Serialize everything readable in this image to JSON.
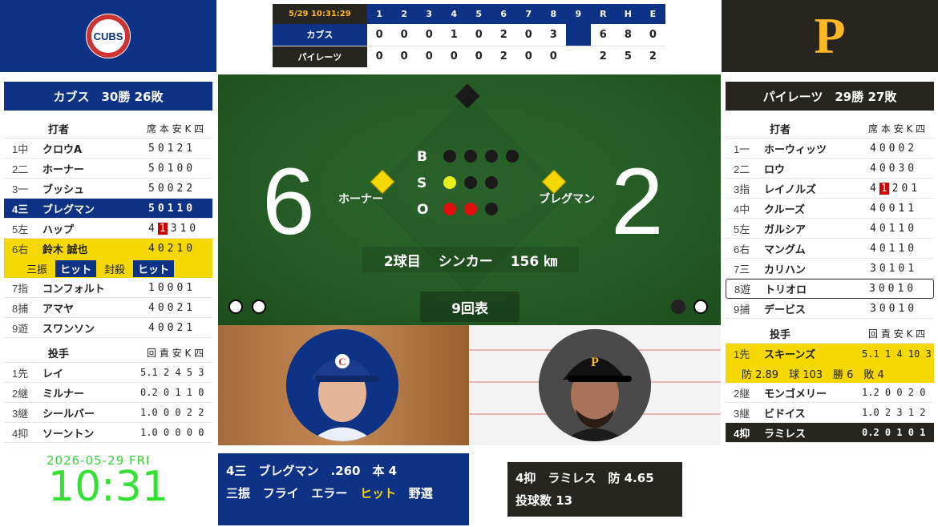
{
  "linescore": {
    "time": "5/29 10:31:29",
    "innings": [
      "1",
      "2",
      "3",
      "4",
      "5",
      "6",
      "7",
      "8",
      "9"
    ],
    "rhe": [
      "R",
      "H",
      "E"
    ],
    "rows": [
      {
        "team": "カブス",
        "scores": [
          "0",
          "0",
          "0",
          "1",
          "0",
          "2",
          "0",
          "3",
          ""
        ],
        "rhe": [
          "6",
          "8",
          "0"
        ]
      },
      {
        "team": "パイレーツ",
        "scores": [
          "0",
          "0",
          "0",
          "0",
          "0",
          "2",
          "0",
          "0",
          ""
        ],
        "rhe": [
          "2",
          "5",
          "2"
        ]
      }
    ]
  },
  "logos": {
    "cubs": "CUBS",
    "pirates": "P"
  },
  "left": {
    "team_header": "カブス　30勝 26敗",
    "batters_header": {
      "title": "打者",
      "cols": "席 本 安 K 四"
    },
    "batters": [
      {
        "ord": "1中",
        "name": "クロウA",
        "stats": "50121"
      },
      {
        "ord": "2二",
        "name": "ホーナー",
        "stats": "50100"
      },
      {
        "ord": "3一",
        "name": "ブッシュ",
        "stats": "50022"
      },
      {
        "ord": "4三",
        "name": "ブレグマン",
        "stats": "50110"
      },
      {
        "ord": "5左",
        "name": "ハップ",
        "stats_pre": "4",
        "stats_hl": "1",
        "stats_post": "310"
      },
      {
        "ord": "6右",
        "name": "鈴木 誠也",
        "stats": "40210"
      },
      {
        "ord": "7指",
        "name": "コンフォルト",
        "stats": "10001"
      },
      {
        "ord": "8捕",
        "name": "アマヤ",
        "stats": "40021"
      },
      {
        "ord": "9遊",
        "name": "スワンソン",
        "stats": "40021"
      }
    ],
    "suzuki_results": [
      "三振",
      "ヒット",
      "封殺",
      "ヒット"
    ],
    "pitchers_header": {
      "title": "投手",
      "cols": "回 責 安 K 四"
    },
    "pitchers": [
      {
        "ord": "1先",
        "name": "レイ",
        "stats": "5.1 2 4 5 3"
      },
      {
        "ord": "2継",
        "name": "ミルナー",
        "stats": "0.2 0 1 1 0"
      },
      {
        "ord": "3継",
        "name": "シールバー",
        "stats": "1.0 0 0 2 2"
      },
      {
        "ord": "4抑",
        "name": "ソーントン",
        "stats": "1.0 0 0 0 0"
      }
    ]
  },
  "right": {
    "team_header": "パイレーツ　29勝 27敗",
    "batters_header": {
      "title": "打者",
      "cols": "席 本 安 K 四"
    },
    "batters": [
      {
        "ord": "1一",
        "name": "ホーウィッツ",
        "stats": "40002"
      },
      {
        "ord": "2二",
        "name": "ロウ",
        "stats": "40030"
      },
      {
        "ord": "3指",
        "name": "レイノルズ",
        "stats_pre": "4",
        "stats_hl": "1",
        "stats_post": "201"
      },
      {
        "ord": "4中",
        "name": "クルーズ",
        "stats": "40011"
      },
      {
        "ord": "5左",
        "name": "ガルシア",
        "stats": "40110"
      },
      {
        "ord": "6右",
        "name": "マングム",
        "stats": "40110"
      },
      {
        "ord": "7三",
        "name": "カリハン",
        "stats": "30101"
      },
      {
        "ord": "8遊",
        "name": "トリオロ",
        "stats": "30010"
      },
      {
        "ord": "9捕",
        "name": "デービス",
        "stats": "30010"
      }
    ],
    "pitchers_header": {
      "title": "投手",
      "cols": "回 責 安 K 四"
    },
    "pitchers": [
      {
        "ord": "1先",
        "name": "スキーンズ",
        "stats": "5.1 1 4 10 3"
      },
      {
        "ord": "2継",
        "name": "モンゴメリー",
        "stats": "1.2 0 0 2 0"
      },
      {
        "ord": "3継",
        "name": "ビドイス",
        "stats": "1.0 2 3 1 2"
      },
      {
        "ord": "4抑",
        "name": "ラミレス",
        "stats": "0.2 0 1 0 1"
      }
    ],
    "skenes_line": "防 2.89　球 103　勝 6　敗 4"
  },
  "field": {
    "away_score": "6",
    "home_score": "2",
    "runner_left": "ホーナー",
    "runner_right": "ブレグマン",
    "labels": {
      "b": "B",
      "s": "S",
      "o": "O"
    },
    "balls": 0,
    "strikes": 1,
    "outs": 2,
    "pitch_count": "2球目",
    "pitch_type": "シンカー",
    "pitch_speed": "156 ㎞",
    "inning": "9回表"
  },
  "batter_card": {
    "line1": "4三　ブレグマン　.260　本 4",
    "results": [
      "三振",
      "フライ",
      "エラー",
      "ヒット",
      "野選"
    ]
  },
  "pitcher_card": {
    "line1": "4抑　ラミレス　防 4.65",
    "line2": "投球数 13"
  },
  "clock": {
    "date": "2026-05-29 FRI",
    "time": "10:31"
  },
  "colors": {
    "cubs_blue": "#0e3386",
    "pirates_black": "#27251f",
    "highlight_yellow": "#f5d800",
    "clock_green": "#35e035"
  }
}
